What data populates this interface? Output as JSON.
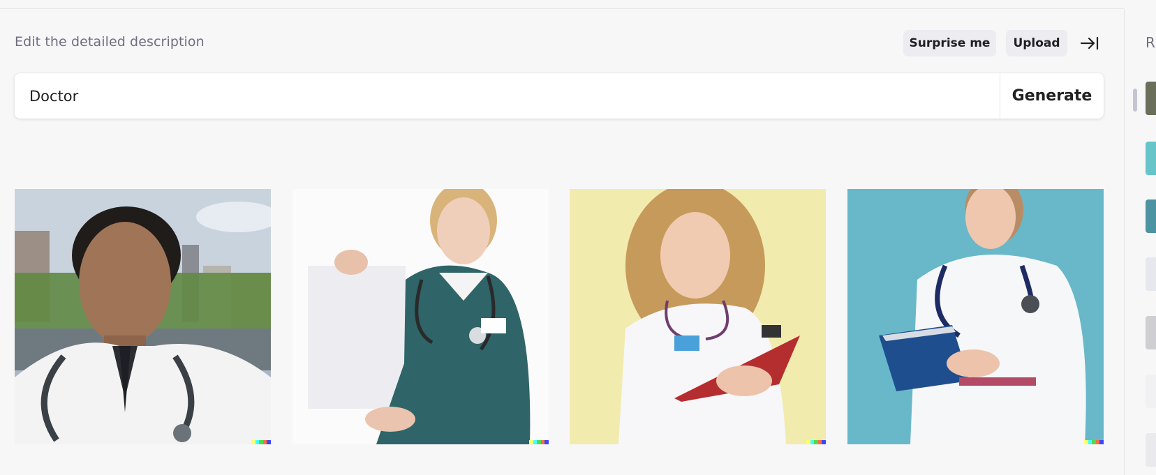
{
  "header": {
    "title": "Edit the detailed description",
    "surprise_label": "Surprise me",
    "upload_label": "Upload",
    "collapse_icon": "arrow-right-to-bar-icon"
  },
  "prompt": {
    "value": "Doctor",
    "generate_label": "Generate"
  },
  "results": {
    "images": [
      {
        "name": "result-image-1",
        "subject": "male doctor with stethoscope outdoors"
      },
      {
        "name": "result-image-2",
        "subject": "nurse in teal scrubs holding blank paper"
      },
      {
        "name": "result-image-3",
        "subject": "curly-haired doctor with red clipboard"
      },
      {
        "name": "result-image-4",
        "subject": "doctor with blue clipboard on teal background"
      }
    ],
    "signature_colors": [
      "#ffff66",
      "#42ffff",
      "#51da4c",
      "#ff6e3c",
      "#3c46ff"
    ]
  },
  "sidebar": {
    "heading": "R",
    "thumb_colors": [
      "#6a6f5c",
      "#67c5c9",
      "#4d94a3",
      "#e7e8ee",
      "#cfcfd3",
      "#f1f1f3",
      "#e9e9ee"
    ]
  }
}
